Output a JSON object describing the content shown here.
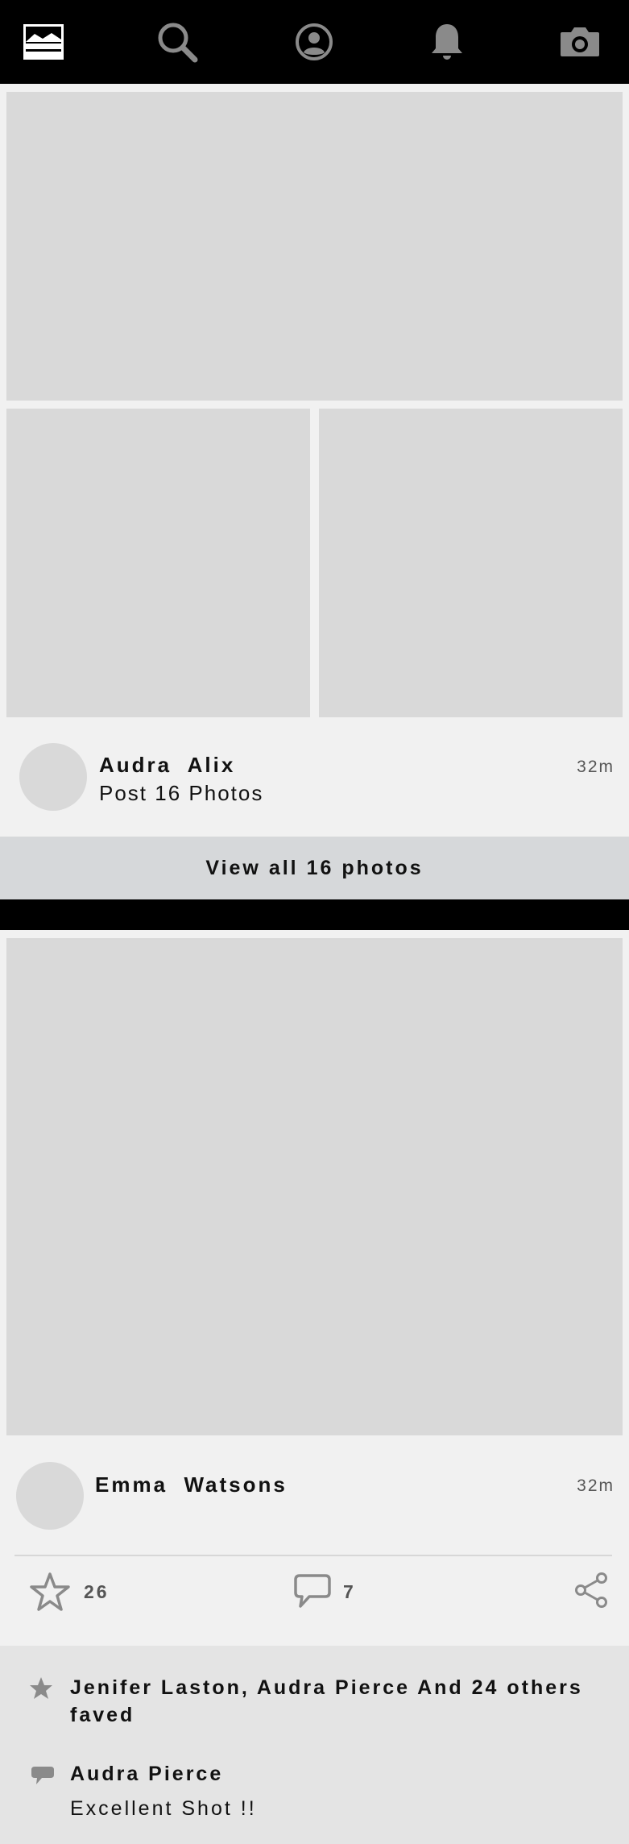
{
  "nav": {
    "icons": [
      "feed-icon",
      "search-icon",
      "profile-icon",
      "bell-icon",
      "camera-icon"
    ]
  },
  "post1": {
    "author": "Audra  Alix",
    "subtitle": "Post 16 Photos",
    "time": "32m",
    "view_all_label": "View all 16 photos"
  },
  "post2": {
    "author": "Emma  Watsons",
    "time": "32m",
    "fav_count": "26",
    "comment_count": "7",
    "faved_text": "Jenifer Laston, Audra  Pierce And 24 others faved",
    "comment_author": "Audra  Pierce",
    "comment_text": "Excellent Shot !!"
  },
  "colors": {
    "nav_bg": "#000000",
    "placeholder": "#d9d9d9",
    "icon_gray": "#8a8a8a",
    "view_all_bg": "#d6d8da",
    "activity_bg": "#e4e4e4"
  }
}
